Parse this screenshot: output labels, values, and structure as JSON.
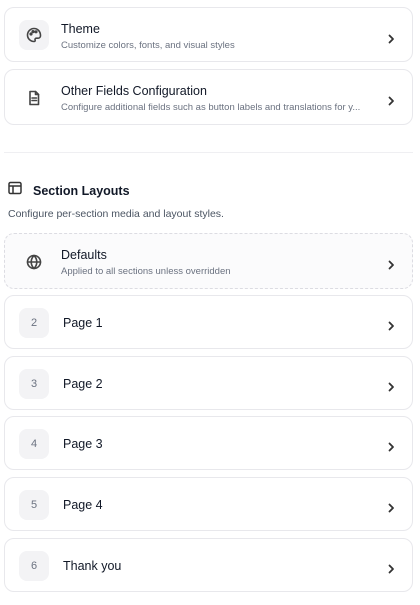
{
  "settings": {
    "theme": {
      "title": "Theme",
      "description": "Customize colors, fonts, and visual styles",
      "icon": "palette-icon"
    },
    "other_fields": {
      "title": "Other Fields Configuration",
      "description": "Configure additional fields such as button labels and translations for y...",
      "icon": "document-icon"
    }
  },
  "section_layouts": {
    "title": "Section Layouts",
    "description": "Configure per-section media and layout styles.",
    "icon": "layout-icon",
    "defaults": {
      "title": "Defaults",
      "description": "Applied to all sections unless overridden",
      "icon": "globe-icon"
    },
    "sections": [
      {
        "number": "2",
        "label": "Page 1"
      },
      {
        "number": "3",
        "label": "Page 2"
      },
      {
        "number": "4",
        "label": "Page 3"
      },
      {
        "number": "5",
        "label": "Page 4"
      },
      {
        "number": "6",
        "label": "Thank you"
      }
    ]
  },
  "colors": {
    "border": "#e8e8ec",
    "text_primary": "#111827",
    "text_secondary": "#6b7280",
    "icon_bg": "#f3f3f5"
  }
}
